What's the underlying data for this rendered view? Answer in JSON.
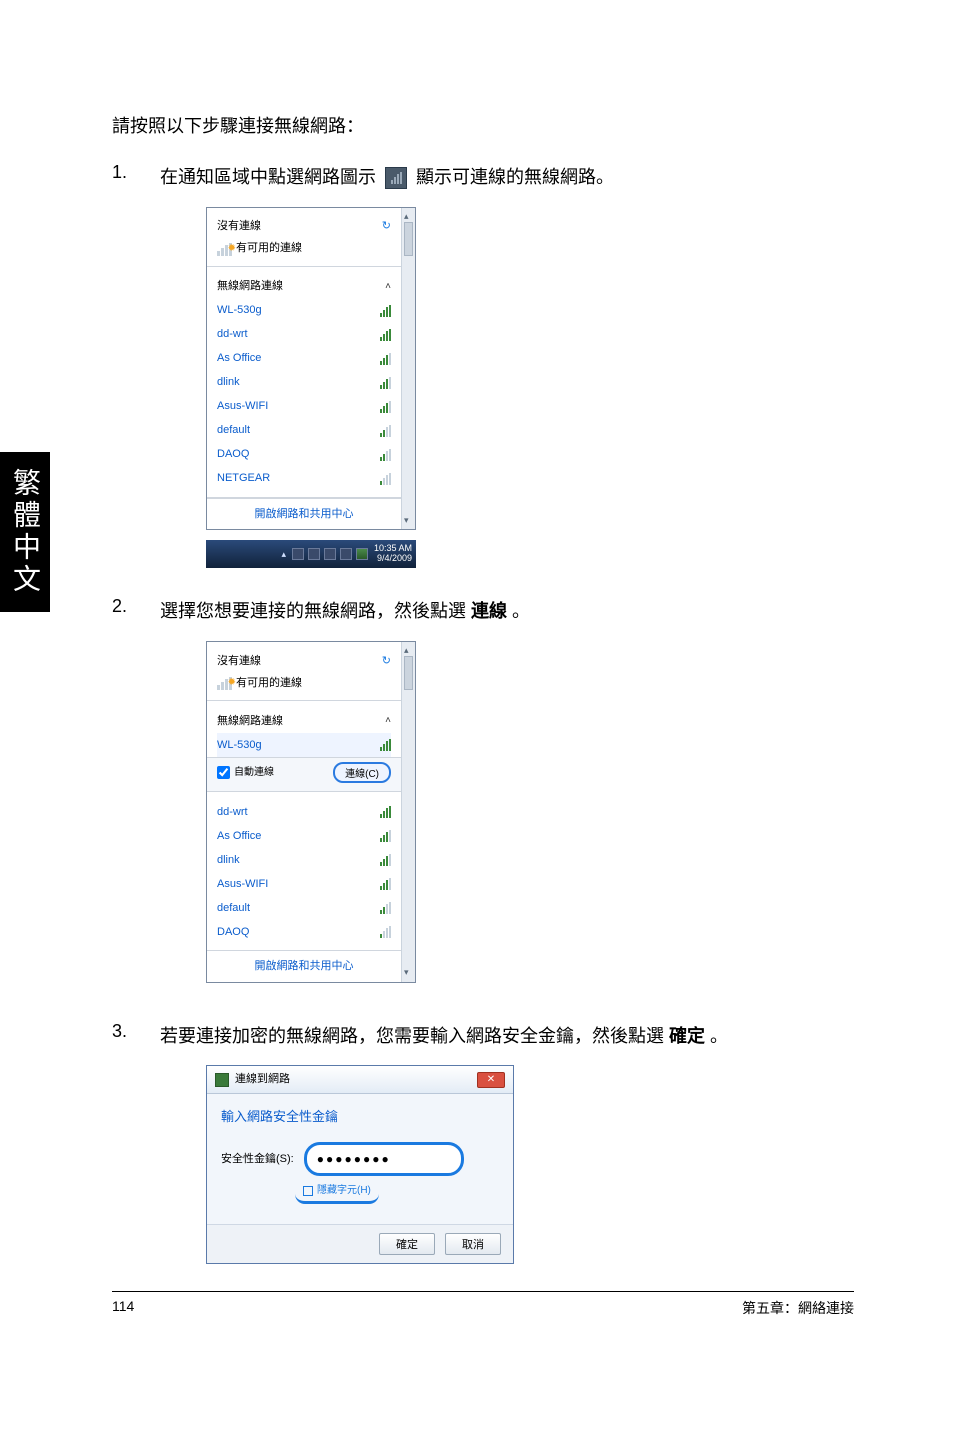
{
  "sidetab": "繁體中文",
  "intro": "請按照以下步驟連接無線網路：",
  "steps": {
    "s1_num": "1.",
    "s1a": "在通知區域中點選網路圖示",
    "s1b": "顯示可連線的無線網路。",
    "s2_num": "2.",
    "s2a": "選擇您想要連接的無線網路，然後點選 ",
    "s2b": "連線",
    "s2c": " 。",
    "s3_num": "3.",
    "s3a": "若要連接加密的無線網路，您需要輸入網路安全金鑰，然後點選 ",
    "s3b": "確定",
    "s3c": " 。"
  },
  "popup": {
    "no_conn": "沒有連線",
    "avail": "有可用的連線",
    "section_wifi": "無線網路連線",
    "net_center": "開啟網路和共用中心",
    "net_center2": "開啟網路和共用中心"
  },
  "wifi1": [
    "WL-530g",
    "dd-wrt",
    "As Office",
    "dlink",
    "Asus-WIFI",
    "default",
    "DAOQ",
    "NETGEAR"
  ],
  "wifi2": [
    "dd-wrt",
    "As Office",
    "dlink",
    "Asus-WIFI",
    "default",
    "DAOQ"
  ],
  "selected_net": "WL-530g",
  "autoconn": "自動連線",
  "connect_btn": "連線(C)",
  "no_conn2": "沒有連線",
  "avail2": "有可用的連線",
  "section_wifi2": "無線網路連線",
  "clock": {
    "time": "10:35 AM",
    "date": "9/4/2009"
  },
  "dialog": {
    "title": "連線到網路",
    "head": "輸入網路安全性金鑰",
    "label": "安全性金鑰(S):",
    "pw": "●●●●●●●●",
    "hide": "隱藏字元(H)",
    "ok": "確定",
    "cancel": "取消"
  },
  "footer": {
    "page": "114",
    "chap": "第五章：網絡連接"
  }
}
